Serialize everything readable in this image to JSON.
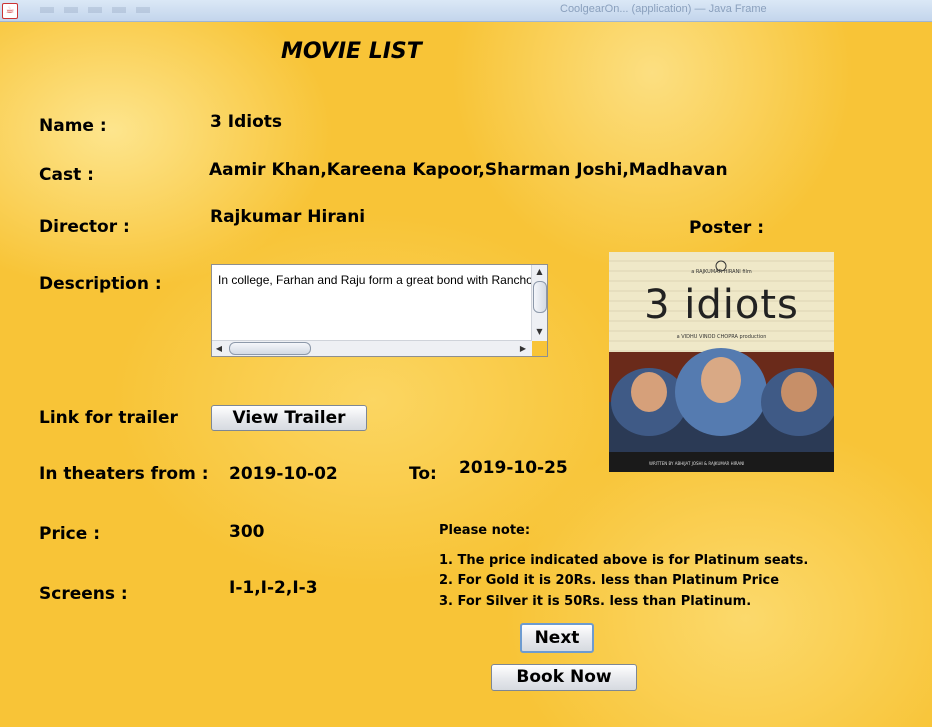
{
  "window": {
    "title": "CoolgearOn... (application) — Java Frame"
  },
  "page": {
    "title": "MOVIE LIST"
  },
  "labels": {
    "name": "Name :",
    "cast": "Cast :",
    "director": "Director :",
    "description": "Description :",
    "trailer": "Link for trailer",
    "theaters_from": "In theaters from :",
    "to": "To:",
    "price": "Price :",
    "screens": "Screens :",
    "poster": "Poster :"
  },
  "movie": {
    "name": "3 Idiots",
    "cast": "Aamir Khan,Kareena Kapoor,Sharman Joshi,Madhavan",
    "director": "Rajkumar Hirani",
    "description": "In college, Farhan and Raju form a great bond with Rancho",
    "from_date": "2019-10-02",
    "to_date": "2019-10-25",
    "price": "300",
    "screens": "I-1,I-2,I-3"
  },
  "poster": {
    "presenter": "a RAJKUMAR HIRANI film",
    "title": "3 idiots",
    "production": "a VIDHU VINOD CHOPRA production",
    "credits": "WRITTEN BY ABHIJAT JOSHI & RAJKUMAR HIRANI"
  },
  "buttons": {
    "view_trailer": "View Trailer",
    "next": "Next",
    "book_now": "Book Now"
  },
  "notes": {
    "heading": "Please note:",
    "lines": [
      "1. The price indicated above is for Platinum seats.",
      "2. For Gold it is 20Rs. less than Platinum Price",
      "3. For Silver it is 50Rs. less than Platinum."
    ]
  },
  "colors": {
    "background": "#f8c437",
    "button_focus_border": "#6d9bd0"
  }
}
